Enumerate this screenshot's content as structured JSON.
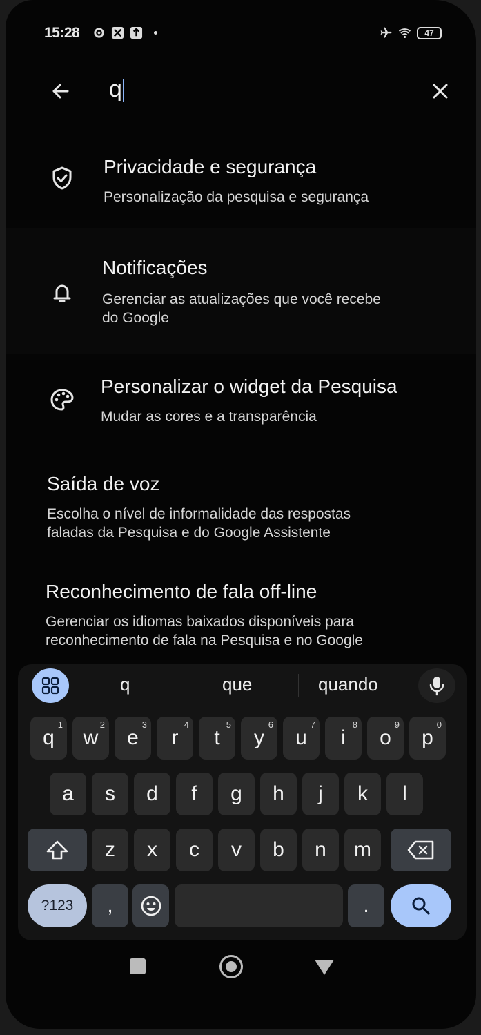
{
  "status": {
    "time": "15:28",
    "battery": "47"
  },
  "search": {
    "query": "q"
  },
  "results": [
    {
      "icon": "shield-check-icon",
      "title": "Privacidade e segurança",
      "subtitle": [
        "Personalização da pesquisa e segurança"
      ]
    },
    {
      "icon": "bell-icon",
      "title": "Notificações",
      "subtitle": [
        "Gerenciar as atualizações que você recebe",
        "do Google"
      ]
    },
    {
      "icon": "palette-icon",
      "title": "Personalizar o widget da Pesquisa",
      "subtitle": [
        "Mudar as cores e a transparência"
      ]
    },
    {
      "icon": "",
      "title": "Saída de voz",
      "subtitle": [
        "Escolha o nível de informalidade das respostas",
        "faladas da Pesquisa e do Google Assistente"
      ]
    },
    {
      "icon": "",
      "title": "Reconhecimento de fala off-line",
      "subtitle": [
        "Gerenciar os idiomas baixados disponíveis para",
        "reconhecimento de fala na Pesquisa e no Google"
      ]
    }
  ],
  "keyboard": {
    "suggestions": [
      "q",
      "que",
      "quando"
    ],
    "row1": [
      {
        "k": "q",
        "n": "1"
      },
      {
        "k": "w",
        "n": "2"
      },
      {
        "k": "e",
        "n": "3"
      },
      {
        "k": "r",
        "n": "4"
      },
      {
        "k": "t",
        "n": "5"
      },
      {
        "k": "y",
        "n": "6"
      },
      {
        "k": "u",
        "n": "7"
      },
      {
        "k": "i",
        "n": "8"
      },
      {
        "k": "o",
        "n": "9"
      },
      {
        "k": "p",
        "n": "0"
      }
    ],
    "row2": [
      "a",
      "s",
      "d",
      "f",
      "g",
      "h",
      "j",
      "k",
      "l"
    ],
    "row3": [
      "z",
      "x",
      "c",
      "v",
      "b",
      "n",
      "m"
    ],
    "symbols_label": "?123",
    "comma": ",",
    "period": "."
  }
}
